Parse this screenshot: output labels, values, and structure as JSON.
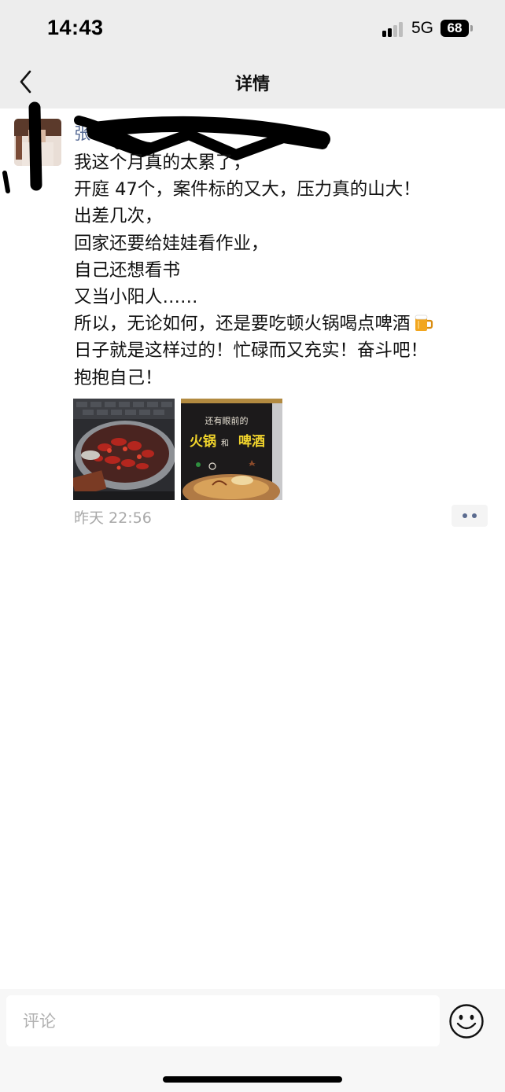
{
  "status_bar": {
    "time": "14:43",
    "network": "5G",
    "battery": "68"
  },
  "nav": {
    "title": "详情",
    "back_icon": "chevron-left-icon"
  },
  "post": {
    "author": "张",
    "lines": [
      "我这个月真的太累了，",
      "开庭 47个，案件标的又大，压力真的山大！",
      "出差几次，",
      "回家还要给娃娃看作业，",
      "自己还想看书",
      "又当小阳人……",
      "所以，无论如何，还是要吃顿火锅喝点啤酒",
      "日子就是这样过的！忙碌而又充实！奋斗吧！",
      "抱抱自己！"
    ],
    "emoji_icon": "beer-mug-icon",
    "images": [
      {
        "name": "hotpot-crayfish-photo"
      },
      {
        "name": "hotpot-beer-poster-photo",
        "lines": [
          "还有眼前的",
          "火锅",
          "和",
          "啤酒"
        ]
      }
    ],
    "timestamp": "昨天 22:56",
    "more_icon": "more-dots-icon"
  },
  "comment_bar": {
    "placeholder": "评论",
    "emoji_icon": "smiley-icon"
  },
  "colors": {
    "bar_bg": "#ededed",
    "link_blue": "#576b95",
    "meta_gray": "#a8a8a8"
  }
}
